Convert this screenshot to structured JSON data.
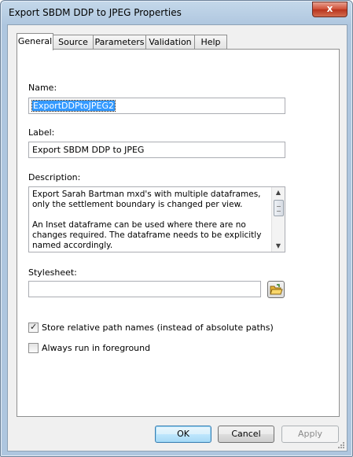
{
  "window": {
    "title": "Export SBDM DDP to JPEG Properties",
    "close_glyph": "x"
  },
  "tabs": [
    "General",
    "Source",
    "Parameters",
    "Validation",
    "Help"
  ],
  "general": {
    "name_label": "Name:",
    "name_value": "ExportDDPtoJPEG2",
    "label_label": "Label:",
    "label_value": "Export SBDM DDP to JPEG",
    "description_label": "Description:",
    "description_text": "Export Sarah Bartman mxd's with multiple dataframes, only the settlement boundary is changed per view.\n\nAn Inset dataframe can be used where there are no changes required. The dataframe needs to be explicitly named accordingly.",
    "stylesheet_label": "Stylesheet:",
    "stylesheet_value": "",
    "store_relative_label": "Store relative path names (instead of absolute paths)",
    "store_relative_checked": true,
    "always_foreground_label": "Always run in foreground",
    "always_foreground_checked": false
  },
  "buttons": {
    "ok": "OK",
    "cancel": "Cancel",
    "apply": "Apply"
  },
  "icons": {
    "close": "close-icon",
    "folder": "open-folder-icon",
    "check": "checkmark-icon",
    "scroll_up": "scroll-up-icon",
    "scroll_down": "scroll-down-icon"
  }
}
